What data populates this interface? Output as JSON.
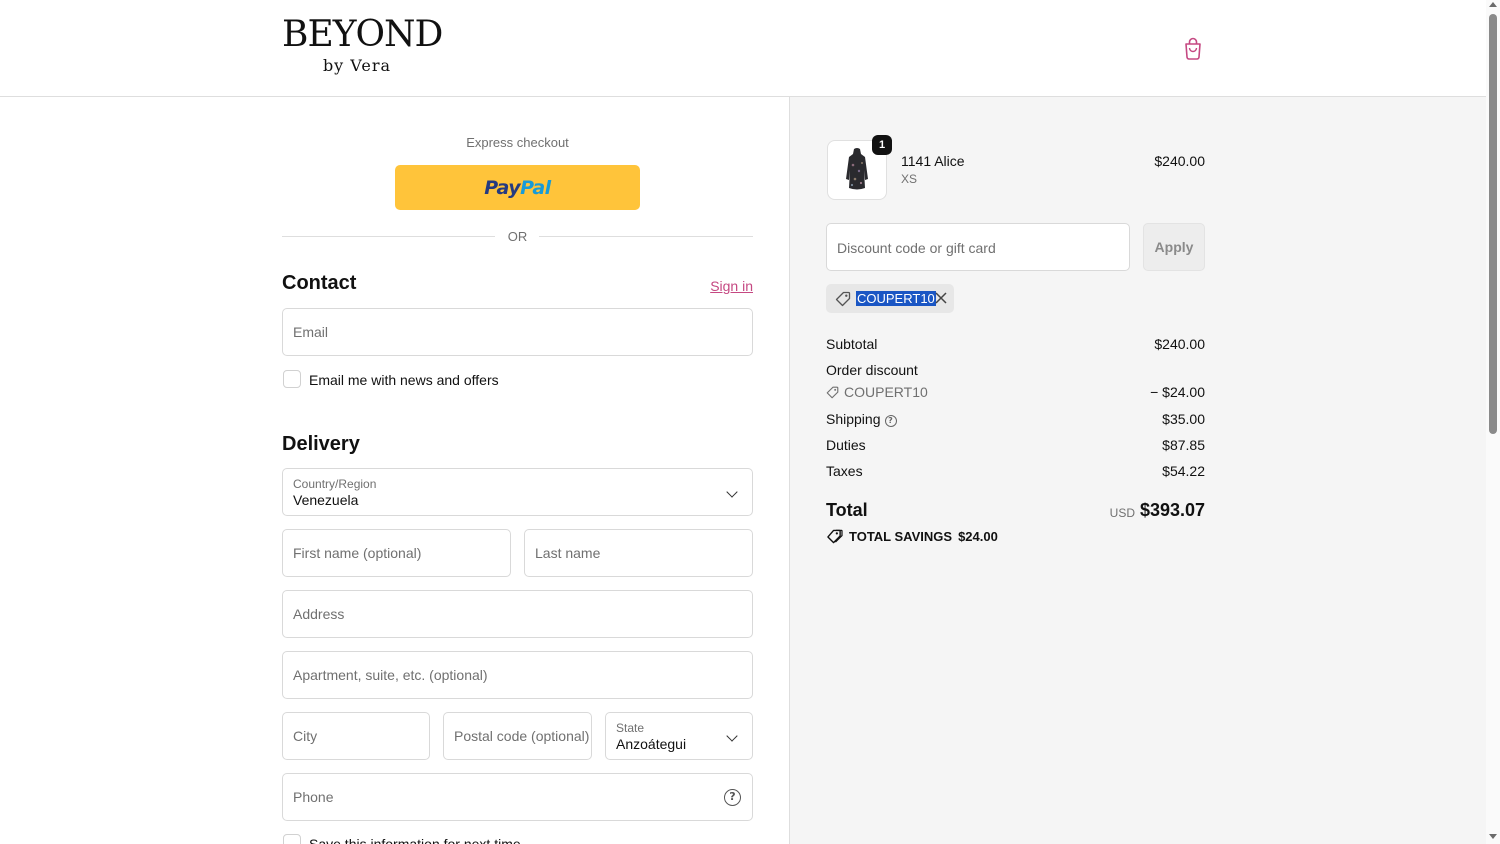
{
  "brand": {
    "name_main": "BEYOND",
    "name_sub": "by Vera"
  },
  "header": {
    "cart_icon": "shopping-bag-icon"
  },
  "express_checkout": {
    "label": "Express checkout",
    "paypal_part1": "Pay",
    "paypal_part2": "Pal",
    "or_text": "OR"
  },
  "contact": {
    "title": "Contact",
    "sign_in": "Sign in",
    "email_placeholder": "Email",
    "news_label": "Email me with news and offers",
    "news_checked": false
  },
  "delivery": {
    "title": "Delivery",
    "country_label": "Country/Region",
    "country_value": "Venezuela",
    "first_name_placeholder": "First name (optional)",
    "last_name_placeholder": "Last name",
    "address_placeholder": "Address",
    "apartment_placeholder": "Apartment, suite, etc. (optional)",
    "city_placeholder": "City",
    "postal_placeholder": "Postal code (optional)",
    "state_label": "State",
    "state_value": "Anzoátegui",
    "phone_placeholder": "Phone",
    "save_info_label": "Save this information for next time"
  },
  "order": {
    "items": [
      {
        "quantity": "1",
        "name": "1141 Alice",
        "variant": "XS",
        "price": "$240.00"
      }
    ],
    "discount_placeholder": "Discount code or gift card",
    "apply_label": "Apply",
    "applied_code": "COUPERT10",
    "subtotal_label": "Subtotal",
    "subtotal_value": "$240.00",
    "order_discount_label": "Order discount",
    "order_discount_code": "COUPERT10",
    "order_discount_value": "− $24.00",
    "shipping_label": "Shipping",
    "shipping_value": "$35.00",
    "duties_label": "Duties",
    "duties_value": "$87.85",
    "taxes_label": "Taxes",
    "taxes_value": "$54.22",
    "total_label": "Total",
    "total_currency": "USD",
    "total_value": "$393.07",
    "savings_label": "TOTAL SAVINGS",
    "savings_value": "$24.00"
  },
  "colors": {
    "accent_link": "#c54882",
    "paypal_yellow": "#ffc43a",
    "selection_blue": "#1a56c4"
  }
}
